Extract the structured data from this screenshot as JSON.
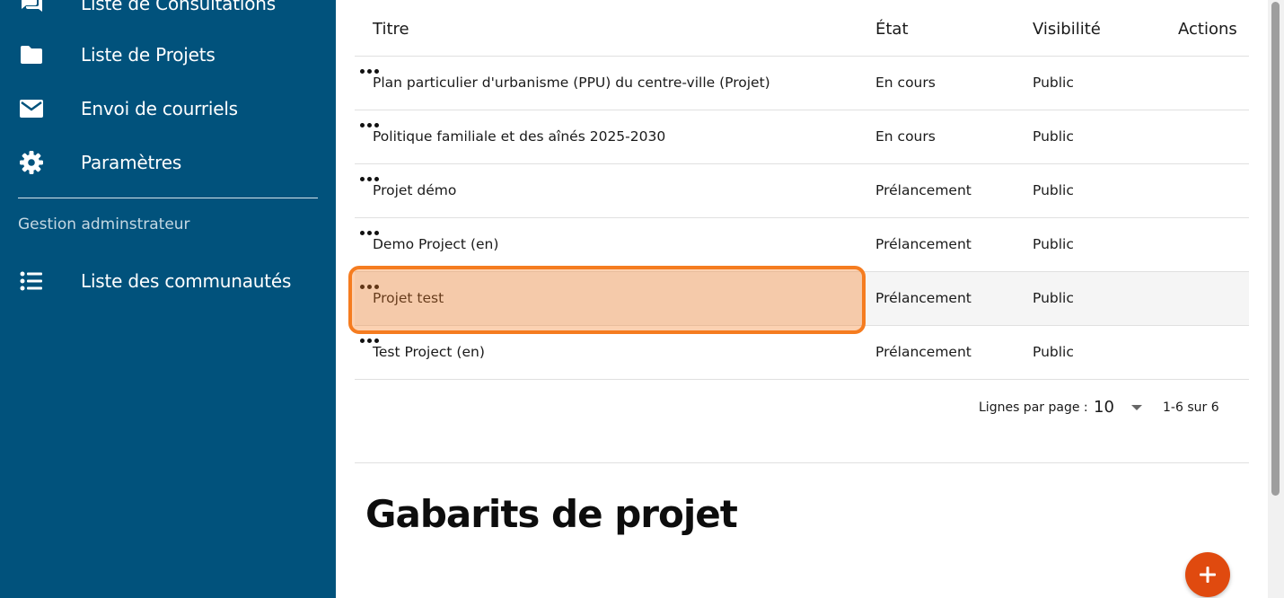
{
  "sidebar": {
    "items": [
      {
        "label": "Liste de Consultations",
        "icon": "forum-icon"
      },
      {
        "label": "Liste de Projets",
        "icon": "folder-icon"
      },
      {
        "label": "Envoi de courriels",
        "icon": "mail-icon"
      },
      {
        "label": "Paramètres",
        "icon": "gear-icon"
      }
    ],
    "section_title": "Gestion adminstrateur",
    "admin_items": [
      {
        "label": "Liste des communautés",
        "icon": "list-icon"
      }
    ],
    "background": "#01527c"
  },
  "table": {
    "headers": {
      "title": "Titre",
      "state": "État",
      "visibility": "Visibilité",
      "actions": "Actions"
    },
    "rows": [
      {
        "title": "Plan particulier d'urbanisme (PPU) du centre-ville (Projet)",
        "state": "En cours",
        "visibility": "Public"
      },
      {
        "title": "Politique familiale et des aînés 2025-2030",
        "state": "En cours",
        "visibility": "Public"
      },
      {
        "title": "Projet démo",
        "state": "Prélancement",
        "visibility": "Public"
      },
      {
        "title": "Demo Project (en)",
        "state": "Prélancement",
        "visibility": "Public"
      },
      {
        "title": "Projet test",
        "state": "Prélancement",
        "visibility": "Public",
        "highlighted": true
      },
      {
        "title": "Test Project (en)",
        "state": "Prélancement",
        "visibility": "Public"
      }
    ]
  },
  "pagination": {
    "rows_per_page_label": "Lignes par page :",
    "rows_per_page": "10",
    "range": "1-6 sur 6"
  },
  "templates_section": {
    "title": "Gabarits de projet",
    "add_button_color": "#e04a0f"
  },
  "highlight_color": "#f57c20"
}
